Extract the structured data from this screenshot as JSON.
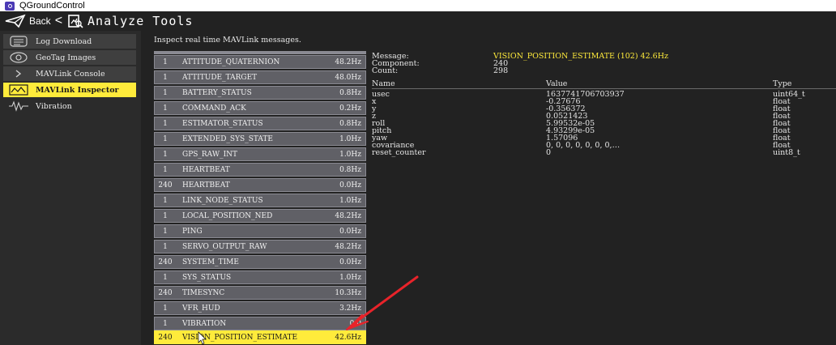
{
  "window": {
    "app_title": "QGroundControl"
  },
  "header": {
    "back_label": "Back",
    "back_chevron": "<",
    "title": "Analyze Tools",
    "icons": [
      "paper-plane-icon",
      "analyze-tools-icon"
    ]
  },
  "sidebar": {
    "items": [
      {
        "label": "Log Download",
        "icon": "log-list-icon",
        "active": false
      },
      {
        "label": "GeoTag Images",
        "icon": "geotag-icon",
        "active": false
      },
      {
        "label": "MAVLink Console",
        "icon": "console-chevron-icon",
        "active": false
      },
      {
        "label": "MAVLink Inspector",
        "icon": "inspector-chart-icon",
        "active": true
      },
      {
        "label": "Vibration",
        "icon": "vibration-wave-icon",
        "active": false
      }
    ]
  },
  "main": {
    "instruction": "Inspect real time MAVLink messages.",
    "messages": [
      {
        "comp": "1",
        "name": "ATTITUDE_QUATERNION",
        "rate": "48.2Hz"
      },
      {
        "comp": "1",
        "name": "ATTITUDE_TARGET",
        "rate": "48.0Hz"
      },
      {
        "comp": "1",
        "name": "BATTERY_STATUS",
        "rate": "0.8Hz"
      },
      {
        "comp": "1",
        "name": "COMMAND_ACK",
        "rate": "0.2Hz"
      },
      {
        "comp": "1",
        "name": "ESTIMATOR_STATUS",
        "rate": "0.8Hz"
      },
      {
        "comp": "1",
        "name": "EXTENDED_SYS_STATE",
        "rate": "1.0Hz"
      },
      {
        "comp": "1",
        "name": "GPS_RAW_INT",
        "rate": "1.0Hz"
      },
      {
        "comp": "1",
        "name": "HEARTBEAT",
        "rate": "0.8Hz"
      },
      {
        "comp": "240",
        "name": "HEARTBEAT",
        "rate": "0.0Hz"
      },
      {
        "comp": "1",
        "name": "LINK_NODE_STATUS",
        "rate": "1.0Hz"
      },
      {
        "comp": "1",
        "name": "LOCAL_POSITION_NED",
        "rate": "48.2Hz"
      },
      {
        "comp": "1",
        "name": "PING",
        "rate": "0.0Hz"
      },
      {
        "comp": "1",
        "name": "SERVO_OUTPUT_RAW",
        "rate": "48.2Hz"
      },
      {
        "comp": "240",
        "name": "SYSTEM_TIME",
        "rate": "0.0Hz"
      },
      {
        "comp": "1",
        "name": "SYS_STATUS",
        "rate": "1.0Hz"
      },
      {
        "comp": "240",
        "name": "TIMESYNC",
        "rate": "10.3Hz"
      },
      {
        "comp": "1",
        "name": "VFR_HUD",
        "rate": "3.2Hz"
      },
      {
        "comp": "1",
        "name": "VIBRATION",
        "rate": "0.0"
      },
      {
        "comp": "240",
        "name": "VISION_POSITION_ESTIMATE",
        "rate": "42.6Hz",
        "selected": true
      }
    ],
    "detail": {
      "message_label": "Message:",
      "message_value": "VISION_POSITION_ESTIMATE (102) 42.6Hz",
      "component_label": "Component:",
      "component_value": "240",
      "count_label": "Count:",
      "count_value": "298",
      "columns": {
        "name": "Name",
        "value": "Value",
        "type": "Type"
      },
      "fields": [
        {
          "name": "usec",
          "value": "1637741706703937",
          "type": "uint64_t"
        },
        {
          "name": "x",
          "value": "-0.27676",
          "type": "float"
        },
        {
          "name": "y",
          "value": "-0.356372",
          "type": "float"
        },
        {
          "name": "z",
          "value": "0.0521423",
          "type": "float"
        },
        {
          "name": "roll",
          "value": "5.99532e-05",
          "type": "float"
        },
        {
          "name": "pitch",
          "value": "4.93299e-05",
          "type": "float"
        },
        {
          "name": "yaw",
          "value": "1.57096",
          "type": "float"
        },
        {
          "name": "covariance",
          "value": "0, 0, 0, 0, 0, 0, 0,…",
          "type": "float"
        },
        {
          "name": "reset_counter",
          "value": "0",
          "type": "uint8_t"
        }
      ]
    }
  },
  "colors": {
    "accent": "#ffeb3b",
    "annotation_arrow": "#e8232a",
    "row_bg": "#606066"
  }
}
